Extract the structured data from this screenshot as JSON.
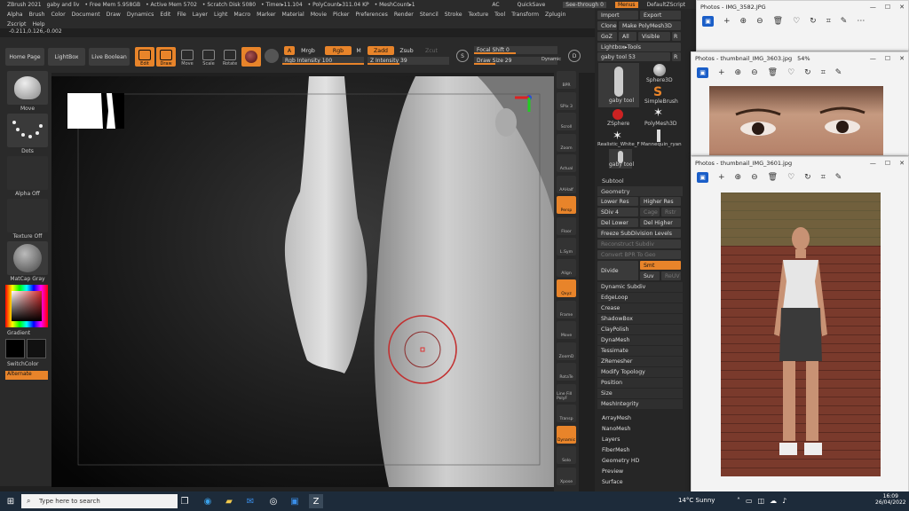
{
  "titlebar": {
    "app": "ZBrush 2021",
    "doc": "gaby and liv",
    "freemem": "• Free Mem 5.958GB",
    "activemem": "• Active Mem 5702",
    "scratch": "• Scratch Disk 5080",
    "timer": "• Timer▸11.104",
    "polycount": "• PolyCount▸311.04 KP",
    "meshcount": "• MeshCount▸1",
    "ac": "AC",
    "quicksave": "QuickSave",
    "seethrough": "See-through 0",
    "menus": "Menus",
    "defaultscript": "DefaultZScript"
  },
  "menu": [
    "Alpha",
    "Brush",
    "Color",
    "Document",
    "Draw",
    "Dynamics",
    "Edit",
    "File",
    "Layer",
    "Light",
    "Macro",
    "Marker",
    "Material",
    "Movie",
    "Picker",
    "Preferences",
    "Render",
    "Stencil",
    "Stroke",
    "Texture",
    "Tool",
    "Transform",
    "Zplugin"
  ],
  "menu2": [
    "Zscript",
    "Help"
  ],
  "coords": "-0.211,0.126,-0.002",
  "shelf": {
    "home": "Home Page",
    "lightbox": "LightBox",
    "liveboolean": "Live Boolean",
    "edit": "Edit",
    "draw": "Draw",
    "move": "Move",
    "scale": "Scale",
    "rotate": "Rotate",
    "a": "A",
    "mrgb": "Mrgb",
    "rgb": "Rgb",
    "m": "M",
    "zadd": "Zadd",
    "zsub": "Zsub",
    "zcut": "Zcut",
    "rgbint": "Rgb Intensity 100",
    "zint": "Z Intensity 39",
    "focal": "Focal Shift 0",
    "drawsize": "Draw Size 29",
    "dynamic": "Dynamic",
    "s": "S",
    "d": "D"
  },
  "left": {
    "move": "Move",
    "dots": "Dots",
    "alphaoff": "Alpha Off",
    "textureoff": "Texture Off",
    "matcap": "MatCap Gray",
    "gradient": "Gradient",
    "switchcolor": "SwitchColor",
    "alternate": "Alternate"
  },
  "rightbar": [
    {
      "l": "BPR",
      "o": false
    },
    {
      "l": "SPix 3",
      "o": false
    },
    {
      "l": "Scroll",
      "o": false
    },
    {
      "l": "Zoom",
      "o": false
    },
    {
      "l": "Actual",
      "o": false
    },
    {
      "l": "AAHalf",
      "o": false
    },
    {
      "l": "Persp",
      "o": true
    },
    {
      "l": "Floor",
      "o": false
    },
    {
      "l": "L.Sym",
      "o": false
    },
    {
      "l": "Align",
      "o": false
    },
    {
      "l": "Qxyz",
      "o": true
    },
    {
      "l": "Frame",
      "o": false
    },
    {
      "l": "Move",
      "o": false
    },
    {
      "l": "ZoomD",
      "o": false
    },
    {
      "l": "RotaTe",
      "o": false
    },
    {
      "l": "Line Fill PolyF",
      "o": false
    },
    {
      "l": "Transp",
      "o": false
    },
    {
      "l": "Dynamic",
      "o": true
    },
    {
      "l": "Solo",
      "o": false
    },
    {
      "l": "Xpose",
      "o": false
    }
  ],
  "panel": {
    "import": "Import",
    "export": "Export",
    "clone": "Clone",
    "makepoly": "Make PolyMesh3D",
    "goz": "GoZ",
    "all": "All",
    "visible": "Visible",
    "r": "R",
    "lightbox_tools": "Lightbox▸Tools",
    "gabytool": "gaby tool 53",
    "r2": "R",
    "tools": [
      "gaby tool",
      "Sphere3D",
      "SimpleBrush",
      "ZSphere",
      "PolyMesh3D",
      "Realistic_White_F",
      "Mannequin_ryan",
      "gaby tool"
    ],
    "subtool": "Subtool",
    "geometry": "Geometry",
    "lowerres": "Lower Res",
    "higherres": "Higher Res",
    "sdiv": "SDiv 4",
    "cage": "Cage",
    "rstr": "Rstr",
    "dellower": "Del Lower",
    "delhigher": "Del Higher",
    "freeze": "Freeze SubDivision Levels",
    "reconstruct": "Reconstruct Subdiv",
    "convertbpr": "Convert BPR To Geo",
    "divide": "Divide",
    "smt": "Smt",
    "suv": "Suv",
    "reuv": "ReUV",
    "items": [
      "Dynamic Subdiv",
      "EdgeLoop",
      "Crease",
      "ShadowBox",
      "ClayPolish",
      "DynaMesh",
      "Tessimate",
      "ZRemesher",
      "Modify Topology",
      "Position",
      "Size",
      "MeshIntegrity"
    ],
    "lower": [
      "ArrayMesh",
      "NanoMesh",
      "Layers",
      "FiberMesh",
      "Geometry HD",
      "Preview",
      "Surface"
    ]
  },
  "photos": [
    {
      "title": "Photos - IMG_3582.JPG"
    },
    {
      "title": "Photos - thumbnail_IMG_3603.jpg",
      "zoom": "54%"
    },
    {
      "title": "Photos - thumbnail_IMG_3601.jpg"
    }
  ],
  "taskbar": {
    "search": "Type here to search",
    "weather": "14°C  Sunny",
    "time": "16:09",
    "date": "26/04/2022"
  }
}
